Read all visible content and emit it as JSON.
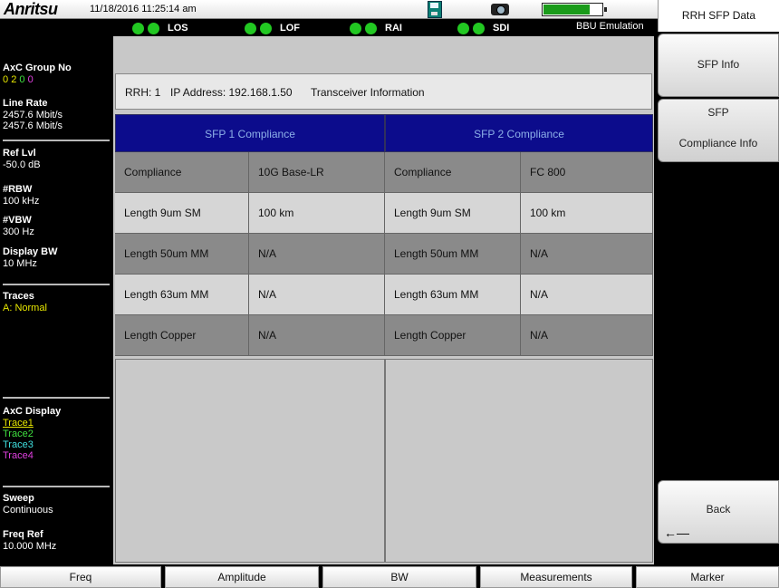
{
  "app": {
    "brand": "Anritsu",
    "datetime": "11/18/2016 11:25:14 am"
  },
  "status": {
    "battery_level_percent": 80,
    "icons": [
      "save-icon",
      "camera-icon",
      "battery-icon"
    ]
  },
  "indicators": [
    {
      "label": "LOS",
      "color": "#22c822"
    },
    {
      "label": "LOF",
      "color": "#22c822"
    },
    {
      "label": "RAI",
      "color": "#22c822"
    },
    {
      "label": "SDI",
      "color": "#22c822"
    }
  ],
  "mode_label": "BBU Emulation",
  "left_panel": {
    "axc_group": {
      "heading": "AxC Group No",
      "digits": [
        {
          "d": "0",
          "color": "#e8e800"
        },
        {
          "d": "2",
          "color": "#e8e800"
        },
        {
          "d": "0",
          "color": "#40e040"
        },
        {
          "d": "0",
          "color": "#e040e0"
        }
      ]
    },
    "line_rate": {
      "heading": "Line Rate",
      "values": [
        "2457.6 Mbit/s",
        "2457.6 Mbit/s"
      ]
    },
    "ref_lvl": {
      "heading": "Ref Lvl",
      "value": "-50.0 dB"
    },
    "rbw": {
      "heading": "#RBW",
      "value": "100 kHz"
    },
    "vbw": {
      "heading": "#VBW",
      "value": "300 Hz"
    },
    "display_bw": {
      "heading": "Display BW",
      "value": "10 MHz"
    },
    "traces": {
      "heading": "Traces",
      "value": "A: Normal"
    },
    "axc_display": {
      "heading": "AxC Display",
      "items": [
        {
          "label": "Trace1",
          "color": "#e8e800"
        },
        {
          "label": "Trace2",
          "color": "#40e040"
        },
        {
          "label": "Trace3",
          "color": "#40e0e0"
        },
        {
          "label": "Trace4",
          "color": "#e040e0"
        }
      ]
    },
    "sweep": {
      "heading": "Sweep",
      "value": "Continuous"
    },
    "freq_ref": {
      "heading": "Freq Ref",
      "value": "10.000 MHz"
    }
  },
  "info_bar": {
    "rrh": "RRH: 1",
    "ip": "IP Address: 192.168.1.50",
    "section": "Transceiver Information"
  },
  "table": {
    "headers": [
      "SFP 1 Compliance",
      "SFP 2 Compliance"
    ],
    "rows": [
      {
        "label1": "Compliance",
        "value1": "10G Base-LR",
        "label2": "Compliance",
        "value2": "FC 800"
      },
      {
        "label1": "Length 9um SM",
        "value1": "100 km",
        "label2": "Length 9um SM",
        "value2": "100 km"
      },
      {
        "label1": "Length 50um MM",
        "value1": "N/A",
        "label2": "Length 50um MM",
        "value2": "N/A"
      },
      {
        "label1": "Length 63um MM",
        "value1": "N/A",
        "label2": "Length 63um MM",
        "value2": "N/A"
      },
      {
        "label1": "Length Copper",
        "value1": "N/A",
        "label2": "Length Copper",
        "value2": "N/A"
      }
    ]
  },
  "softkeys": {
    "title": "RRH SFP Data",
    "sfp_info": "SFP Info",
    "sfp_compliance_line1": "SFP",
    "sfp_compliance_line2": "Compliance Info",
    "back": "Back",
    "back_arrow": "←—"
  },
  "bottom_menu": [
    "Freq",
    "Amplitude",
    "BW",
    "Measurements",
    "Marker"
  ]
}
